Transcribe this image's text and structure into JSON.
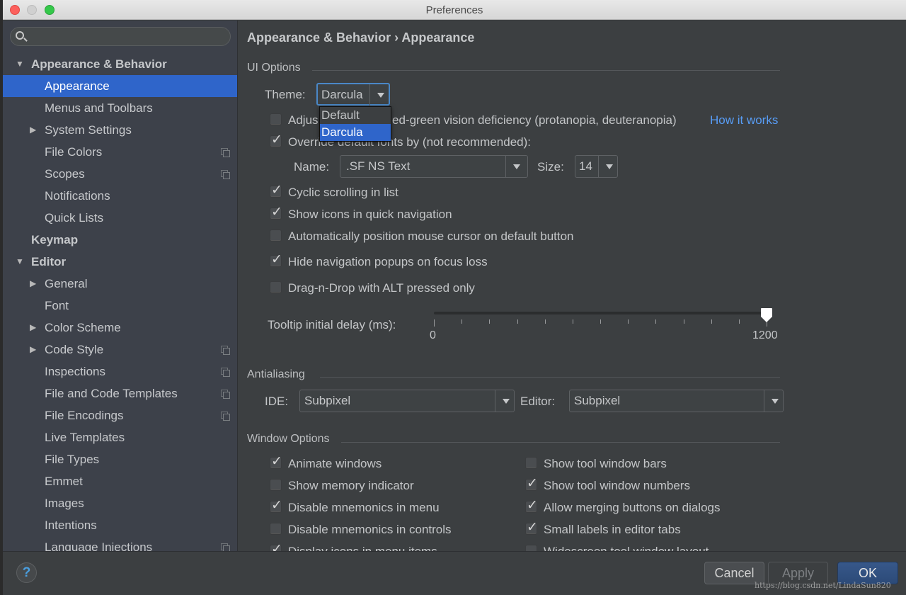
{
  "window": {
    "title": "Preferences"
  },
  "sidebar": {
    "search_placeholder": "",
    "items": [
      {
        "label": "Appearance & Behavior",
        "level": 0,
        "bold": true,
        "expanded": true
      },
      {
        "label": "Appearance",
        "level": 1,
        "selected": true
      },
      {
        "label": "Menus and Toolbars",
        "level": 1
      },
      {
        "label": "System Settings",
        "level": 1,
        "collapsed": true
      },
      {
        "label": "File Colors",
        "level": 1,
        "copy_icon": true
      },
      {
        "label": "Scopes",
        "level": 1,
        "copy_icon": true
      },
      {
        "label": "Notifications",
        "level": 1
      },
      {
        "label": "Quick Lists",
        "level": 1
      },
      {
        "label": "Keymap",
        "level": 0,
        "bold": true
      },
      {
        "label": "Editor",
        "level": 0,
        "bold": true,
        "expanded": true
      },
      {
        "label": "General",
        "level": 1,
        "collapsed": true
      },
      {
        "label": "Font",
        "level": 1
      },
      {
        "label": "Color Scheme",
        "level": 1,
        "collapsed": true
      },
      {
        "label": "Code Style",
        "level": 1,
        "collapsed": true,
        "copy_icon": true
      },
      {
        "label": "Inspections",
        "level": 1,
        "copy_icon": true
      },
      {
        "label": "File and Code Templates",
        "level": 1,
        "copy_icon": true
      },
      {
        "label": "File Encodings",
        "level": 1,
        "copy_icon": true
      },
      {
        "label": "Live Templates",
        "level": 1
      },
      {
        "label": "File Types",
        "level": 1
      },
      {
        "label": "Emmet",
        "level": 1
      },
      {
        "label": "Images",
        "level": 1
      },
      {
        "label": "Intentions",
        "level": 1
      },
      {
        "label": "Language Injections",
        "level": 1,
        "copy_icon": true
      }
    ]
  },
  "content": {
    "breadcrumb": "Appearance & Behavior › Appearance",
    "ui_options": {
      "title": "UI Options",
      "theme_label": "Theme:",
      "theme_value": "Darcula",
      "theme_options": [
        "Default",
        "Darcula"
      ],
      "theme_options_selected": "Darcula",
      "adjust_colors": {
        "label": "Adjust colors for red-green vision deficiency (protanopia, deuteranopia)",
        "visible_suffix": "ed-green vision deficiency (protanopia, deuteranopia)",
        "visible_prefix": "Adjus",
        "checked": false
      },
      "how_it_works": "How it works",
      "override_fonts": {
        "label": "Override default fonts by (not recommended):",
        "checked": true
      },
      "font_name_label": "Name:",
      "font_name_value": ".SF NS Text",
      "font_size_label": "Size:",
      "font_size_value": "14",
      "options": [
        {
          "label": "Cyclic scrolling in list",
          "checked": true
        },
        {
          "label": "Show icons in quick navigation",
          "checked": true
        },
        {
          "label": "Automatically position mouse cursor on default button",
          "checked": false
        },
        {
          "label": "Hide navigation popups on focus loss",
          "checked": true
        },
        {
          "label": "Drag-n-Drop with ALT pressed only",
          "checked": false
        }
      ],
      "tooltip_label": "Tooltip initial delay (ms):",
      "tooltip_min": "0",
      "tooltip_max": "1200",
      "tooltip_value": 1200
    },
    "antialiasing": {
      "title": "Antialiasing",
      "ide_label": "IDE:",
      "ide_value": "Subpixel",
      "editor_label": "Editor:",
      "editor_value": "Subpixel"
    },
    "window_options": {
      "title": "Window Options",
      "left": [
        {
          "label": "Animate windows",
          "checked": true
        },
        {
          "label": "Show memory indicator",
          "checked": false
        },
        {
          "label": "Disable mnemonics in menu",
          "checked": true
        },
        {
          "label": "Disable mnemonics in controls",
          "checked": false
        },
        {
          "label": "Display icons in menu items",
          "checked": true
        }
      ],
      "right": [
        {
          "label": "Show tool window bars",
          "checked": false
        },
        {
          "label": "Show tool window numbers",
          "checked": true
        },
        {
          "label": "Allow merging buttons on dialogs",
          "checked": true
        },
        {
          "label": "Small labels in editor tabs",
          "checked": true
        },
        {
          "label": "Widescreen tool window layout",
          "checked": false
        }
      ]
    }
  },
  "footer": {
    "help_label": "?",
    "cancel_label": "Cancel",
    "apply_label": "Apply",
    "ok_label": "OK"
  },
  "watermark": "https://blog.csdn.net/LindaSun820",
  "colors": {
    "accent": "#2f65ca",
    "link": "#589df6",
    "background": "#3c3f41",
    "sidebar": "#3d414a"
  }
}
